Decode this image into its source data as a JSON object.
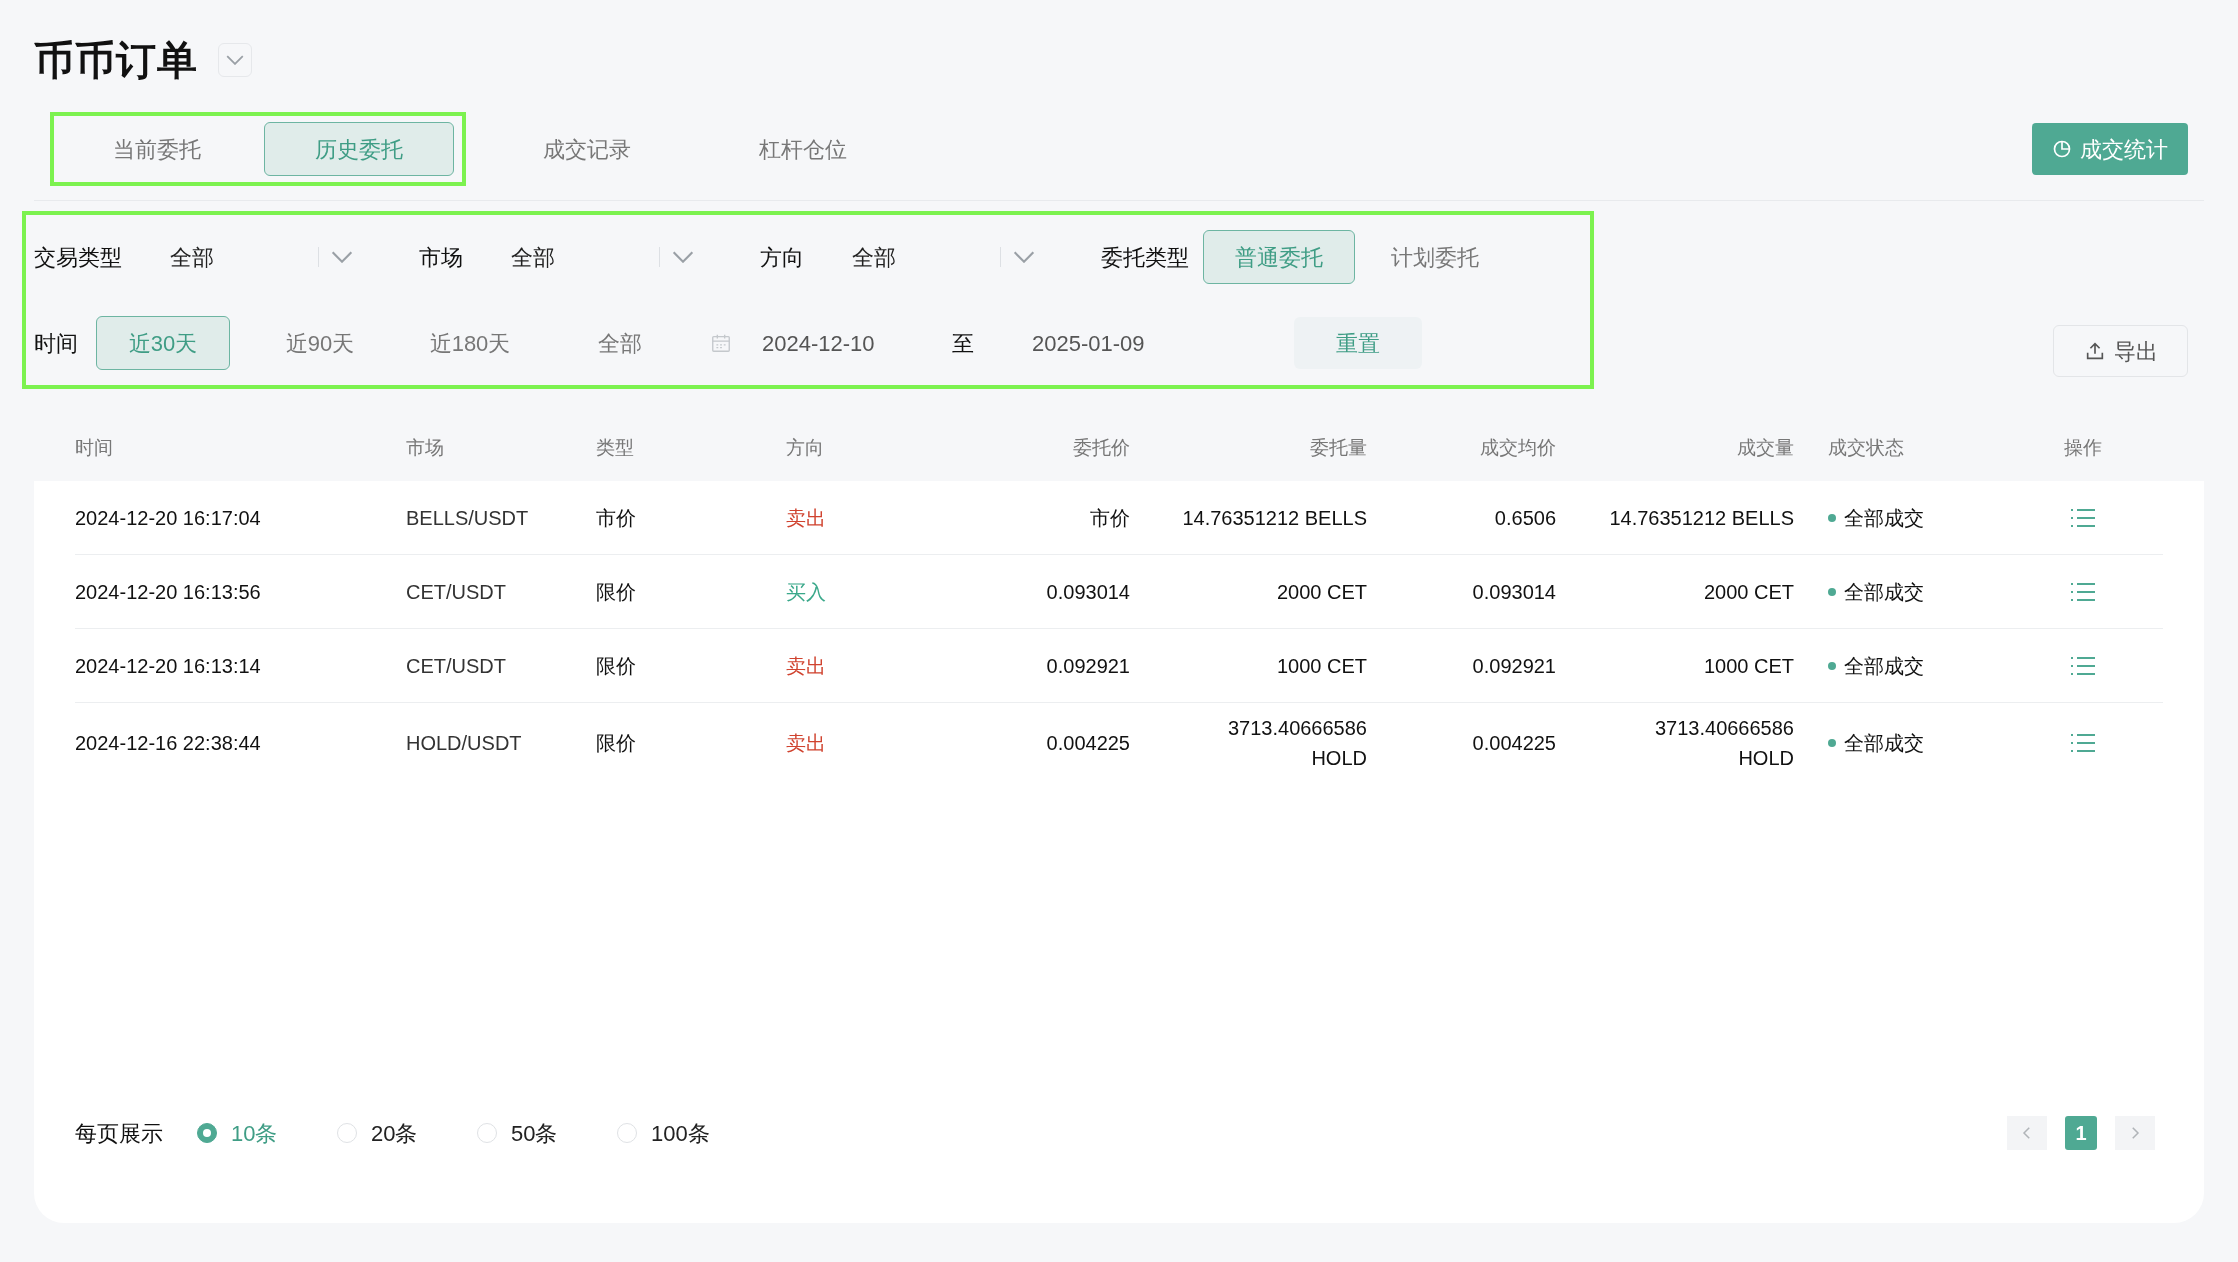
{
  "title": "币币订单",
  "tabs": [
    {
      "label": "当前委托",
      "selected": false
    },
    {
      "label": "历史委托",
      "selected": true
    },
    {
      "label": "成交记录",
      "selected": false
    },
    {
      "label": "杠杆仓位",
      "selected": false
    }
  ],
  "stats_button": {
    "label": "成交统计"
  },
  "filters": {
    "selects": [
      {
        "label": "交易类型",
        "value": "全部"
      },
      {
        "label": "市场",
        "value": "全部"
      },
      {
        "label": "方向",
        "value": "全部"
      }
    ],
    "order_type": {
      "label": "委托类型",
      "options": [
        {
          "label": "普通委托",
          "selected": true
        },
        {
          "label": "计划委托",
          "selected": false
        }
      ]
    },
    "time": {
      "label": "时间",
      "options": [
        {
          "label": "近30天",
          "selected": true
        },
        {
          "label": "近90天",
          "selected": false
        },
        {
          "label": "近180天",
          "selected": false
        },
        {
          "label": "全部",
          "selected": false
        }
      ]
    },
    "date_from": "2024-12-10",
    "date_separator": "至",
    "date_to": "2025-01-09",
    "reset": "重置"
  },
  "export_button": {
    "label": "导出"
  },
  "table": {
    "columns": [
      "时间",
      "市场",
      "类型",
      "方向",
      "委托价",
      "委托量",
      "成交均价",
      "成交量",
      "成交状态",
      "操作"
    ],
    "rows": [
      {
        "time": "2024-12-20 16:17:04",
        "market": "BELLS/USDT",
        "type": "市价",
        "side": {
          "label": "卖出",
          "kind": "sell"
        },
        "price": "市价",
        "amount": "14.76351212 BELLS",
        "avg_price": "0.6506",
        "filled": "14.76351212 BELLS",
        "status": "全部成交"
      },
      {
        "time": "2024-12-20 16:13:56",
        "market": "CET/USDT",
        "type": "限价",
        "side": {
          "label": "买入",
          "kind": "buy"
        },
        "price": "0.093014",
        "amount": "2000 CET",
        "avg_price": "0.093014",
        "filled": "2000 CET",
        "status": "全部成交"
      },
      {
        "time": "2024-12-20 16:13:14",
        "market": "CET/USDT",
        "type": "限价",
        "side": {
          "label": "卖出",
          "kind": "sell"
        },
        "price": "0.092921",
        "amount": "1000 CET",
        "avg_price": "0.092921",
        "filled": "1000 CET",
        "status": "全部成交"
      },
      {
        "time": "2024-12-16 22:38:44",
        "market": "HOLD/USDT",
        "type": "限价",
        "side": {
          "label": "卖出",
          "kind": "sell"
        },
        "price": "0.004225",
        "amount": "3713.40666586 HOLD",
        "avg_price": "0.004225",
        "filled": "3713.40666586 HOLD",
        "status": "全部成交"
      }
    ]
  },
  "pagination": {
    "label": "每页展示",
    "sizes": [
      {
        "label": "10条",
        "selected": true
      },
      {
        "label": "20条",
        "selected": false
      },
      {
        "label": "50条",
        "selected": false
      },
      {
        "label": "100条",
        "selected": false
      }
    ],
    "pages": [
      {
        "label": "1",
        "selected": true
      }
    ]
  }
}
